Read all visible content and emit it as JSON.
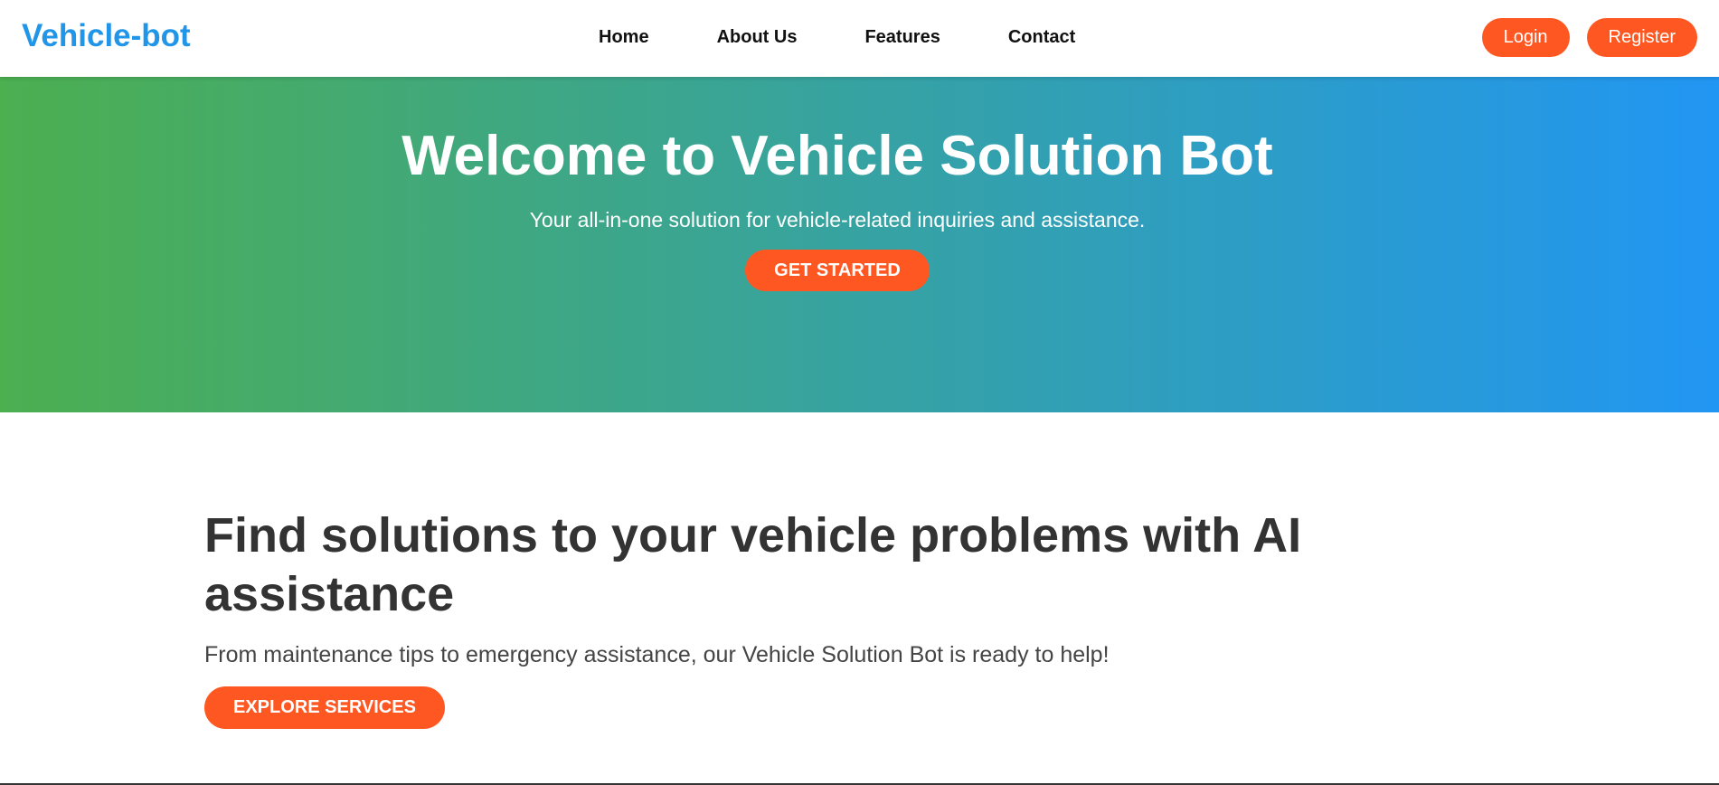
{
  "navbar": {
    "brand": "Vehicle-bot",
    "links": [
      "Home",
      "About Us",
      "Features",
      "Contact"
    ],
    "login_label": "Login",
    "register_label": "Register"
  },
  "hero": {
    "title": "Welcome to Vehicle Solution Bot",
    "subtitle": "Your all-in-one solution for vehicle-related inquiries and assistance.",
    "cta_label": "GET STARTED"
  },
  "info": {
    "heading": "Find solutions to your vehicle problems with AI assistance",
    "description": "From maintenance tips to emergency assistance, our Vehicle Solution Bot is ready to help!",
    "cta_label": "EXPLORE SERVICES"
  },
  "colors": {
    "brand": "#2196e8",
    "accent": "#ff5722",
    "gradient_start": "#4caf50",
    "gradient_end": "#2196f3",
    "heading_text": "#333333"
  }
}
